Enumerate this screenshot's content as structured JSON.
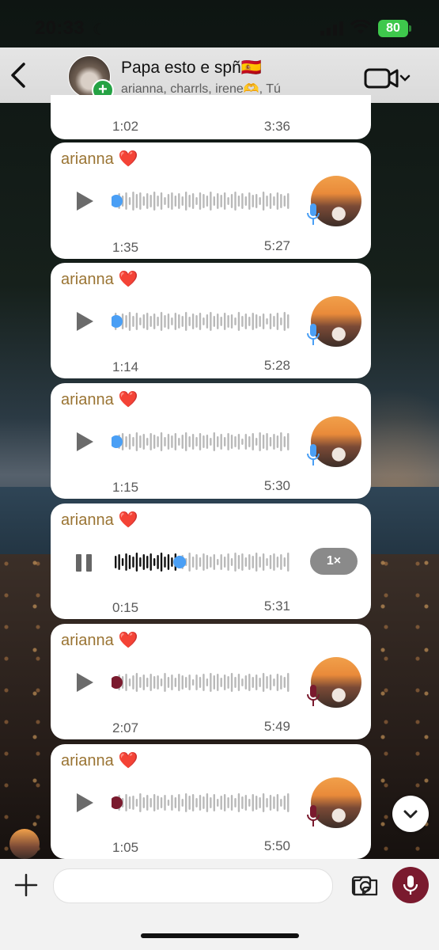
{
  "status": {
    "time": "20:33",
    "battery": "80"
  },
  "header": {
    "title": "Papa esto e spñ🇪🇸",
    "subtitle": "arianna, charrls, irene🫶, Tú"
  },
  "top_partial": {
    "elapsed": "1:02",
    "duration": "3:36"
  },
  "messages": [
    {
      "sender": "arianna",
      "heart": "❤️",
      "elapsed": "1:35",
      "duration": "5:27",
      "state": "unplayed"
    },
    {
      "sender": "arianna",
      "heart": "❤️",
      "elapsed": "1:14",
      "duration": "5:28",
      "state": "unplayed"
    },
    {
      "sender": "arianna",
      "heart": "❤️",
      "elapsed": "1:15",
      "duration": "5:30",
      "state": "unplayed"
    },
    {
      "sender": "arianna",
      "heart": "❤️",
      "elapsed": "0:15",
      "duration": "5:31",
      "state": "playing",
      "speed": "1×",
      "progress": 0.37
    },
    {
      "sender": "arianna",
      "heart": "❤️",
      "elapsed": "2:07",
      "duration": "5:49",
      "state": "played"
    },
    {
      "sender": "arianna",
      "heart": "❤️",
      "elapsed": "1:05",
      "duration": "5:50",
      "state": "played"
    }
  ],
  "colors": {
    "unplayed_dot": "#4a9ff5",
    "played_dot": "#7a1a2e",
    "sender": "#9a7433",
    "record_button": "#7a1a2e"
  },
  "icons": {
    "back": "chevron-left-icon",
    "video": "video-camera-icon",
    "play": "play-icon",
    "pause": "pause-icon",
    "mic": "microphone-icon",
    "add": "plus-icon",
    "sticker": "sticker-icon",
    "camera": "camera-icon",
    "scroll": "chevron-down-icon"
  }
}
